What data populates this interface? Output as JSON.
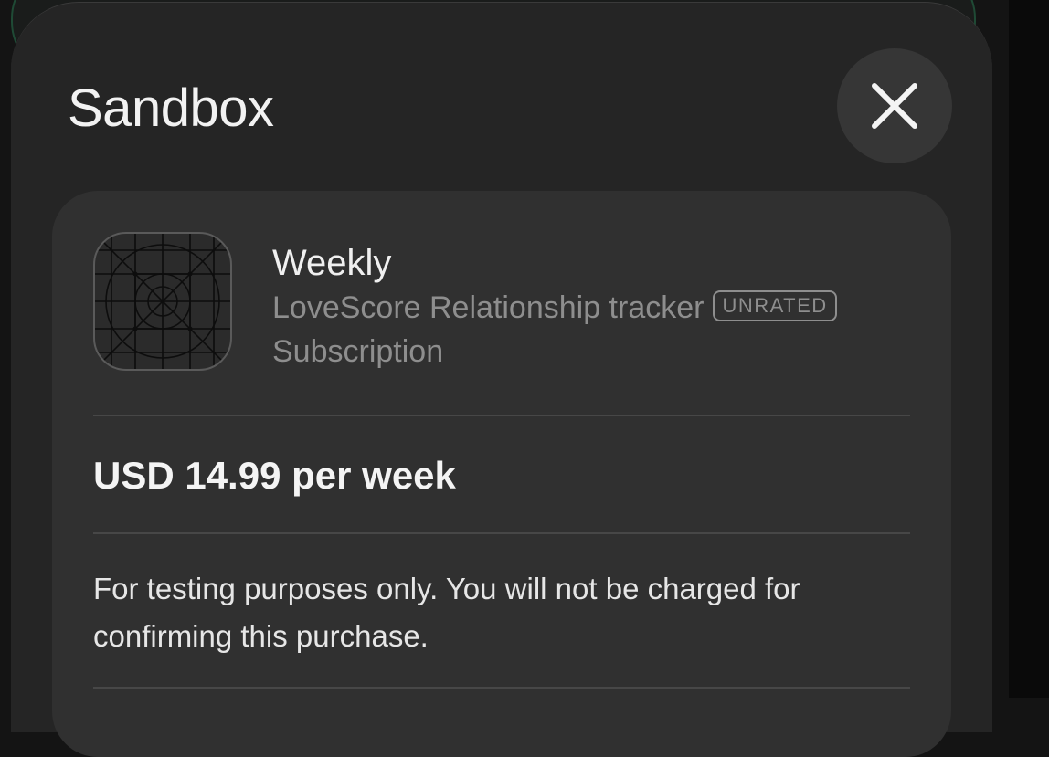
{
  "sheet": {
    "title": "Sandbox",
    "close_icon": "close-icon"
  },
  "product": {
    "name": "Weekly",
    "app_name": "LoveScore Relationship tracker",
    "age_rating": "UNRATED",
    "type": "Subscription",
    "icon": "app-icon-placeholder-grid"
  },
  "price": {
    "label": "USD 14.99 per week"
  },
  "notice": {
    "text": "For testing purposes only. You will not be charged for confirming this purchase."
  },
  "colors": {
    "sheet_bg": "#252525",
    "card_bg": "#303030",
    "secondary_text": "#8e8e8e",
    "primary_text": "#f2f2f2"
  }
}
